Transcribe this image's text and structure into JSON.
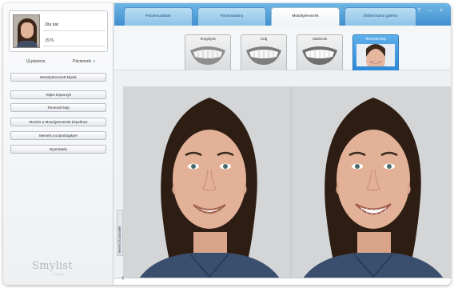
{
  "patient": {
    "name": "Zita pác",
    "id": "1576"
  },
  "sidebar": {
    "new_patient": "Új páciens",
    "patients": "Páciensek",
    "buttons": [
      "Mosolytervezett képek",
      "Teljes képernyő",
      "Tervezett kép",
      "Mentés a Mosolytervezett képekhez",
      "Mentés a számítógépre",
      "Nyomtatás"
    ],
    "vertical_tab": "Mentett foutanulék",
    "logo": "Smylist",
    "logo_sub": "clinical"
  },
  "main_tabs": [
    {
      "label": "Páciensadatok",
      "active": false
    },
    {
      "label": "Páciensalany",
      "active": false
    },
    {
      "label": "Mosolytervezés",
      "active": true
    },
    {
      "label": "Előtte/Utána galéria",
      "active": false
    }
  ],
  "window_controls": "? – ×",
  "smile_tabs": [
    {
      "label": "Tengelyek",
      "active": false
    },
    {
      "label": "Száj",
      "active": false
    },
    {
      "label": "Sablonok",
      "active": false
    },
    {
      "label": "Tervezett kép",
      "active": true
    }
  ],
  "colors": {
    "accent": "#3f8fcf",
    "active_tab": "#2d88d6"
  }
}
